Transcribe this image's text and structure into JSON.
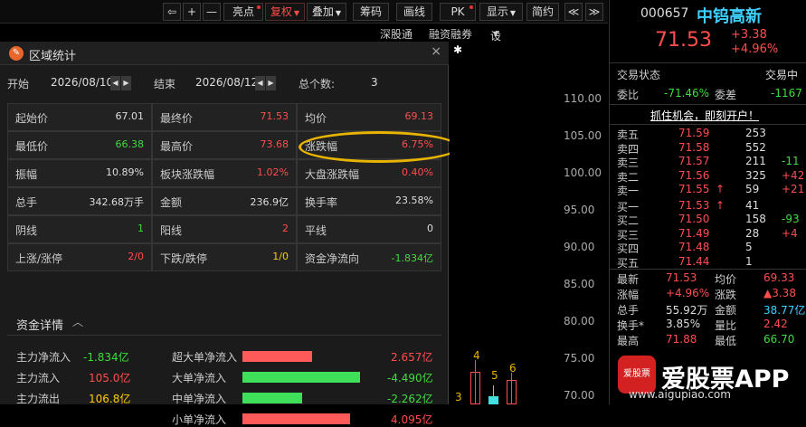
{
  "toolbar": {
    "back": "⇦",
    "plus": "+",
    "minus": "—",
    "liangdian": "亮点",
    "fuquan": "复权",
    "diejia": "叠加",
    "chouma": "筹码",
    "huaxian": "画线",
    "pk": "PK",
    "xianshi": "显示",
    "jianyue": "简约",
    "prev": "≪",
    "next": "≫"
  },
  "subbar": {
    "shengutong": "深股通",
    "rongzi": "融资融券",
    "junxian": "设置均线"
  },
  "panel": {
    "title": "区域统计",
    "close": "×",
    "range": {
      "start_label": "开始",
      "start": "2026/08/10",
      "end_label": "结束",
      "end": "2026/08/12",
      "count_label": "总个数:",
      "count": "3"
    },
    "cells": [
      {
        "label": "起始价",
        "value": "67.01"
      },
      {
        "label": "最终价",
        "value": "71.53"
      },
      {
        "label": "均价",
        "value": "69.13"
      },
      {
        "label": "最低价",
        "value": "66.38"
      },
      {
        "label": "最高价",
        "value": "73.68"
      },
      {
        "label": "涨跌幅",
        "value": "6.75%"
      },
      {
        "label": "振幅",
        "value": "10.89%"
      },
      {
        "label": "板块涨跌幅",
        "value": "1.02%"
      },
      {
        "label": "大盘涨跌幅",
        "value": "0.40%"
      },
      {
        "label": "总手",
        "value": "342.68万手"
      },
      {
        "label": "金额",
        "value": "236.9亿"
      },
      {
        "label": "换手率",
        "value": "23.58%"
      },
      {
        "label": "阴线",
        "value": "1"
      },
      {
        "label": "阳线",
        "value": "2"
      },
      {
        "label": "平线",
        "value": "0"
      },
      {
        "label": "上涨/涨停",
        "value": "2/0"
      },
      {
        "label": "下跌/跌停",
        "value": "1/0"
      },
      {
        "label": "资金净流向",
        "value": "-1.834亿"
      }
    ],
    "fund": {
      "header": "资金详情",
      "chev": "︿",
      "left": [
        {
          "label": "主力净流入",
          "value": "-1.834亿"
        },
        {
          "label": "主力流入",
          "value": "105.0亿"
        },
        {
          "label": "主力流出",
          "value": "106.8亿"
        }
      ],
      "right": [
        {
          "label": "超大单净流入",
          "value": "2.657亿",
          "level": 0.55
        },
        {
          "label": "大单净流入",
          "value": "-4.490亿",
          "level": 0.93
        },
        {
          "label": "中单净流入",
          "value": "-2.262亿",
          "level": 0.47
        },
        {
          "label": "小单净流入",
          "value": "4.095亿",
          "level": 0.85
        }
      ]
    }
  },
  "chart": {
    "star": "✱",
    "yticks": [
      "110.00",
      "105.00",
      "100.00",
      "95.00",
      "90.00",
      "85.00",
      "80.00",
      "75.00",
      "70.00"
    ],
    "marks": [
      "4",
      "5",
      "6",
      "3"
    ]
  },
  "quote": {
    "code": "000657",
    "name": "中钨高新",
    "price": "71.53",
    "chg": "+3.38",
    "pct": "+4.96%",
    "status_label": "交易状态",
    "status": "交易中",
    "wb_label": "委比",
    "wb": "-71.46%",
    "wc_label": "委差",
    "wc": "-1167",
    "banner": "抓住机会，即刻开户！",
    "asks": [
      {
        "l": "卖五",
        "p": "71.59",
        "v": "253",
        "d": ""
      },
      {
        "l": "卖四",
        "p": "71.58",
        "v": "552",
        "d": ""
      },
      {
        "l": "卖三",
        "p": "71.57",
        "v": "211",
        "d": "-11"
      },
      {
        "l": "卖二",
        "p": "71.56",
        "v": "325",
        "d": "+42"
      },
      {
        "l": "卖一",
        "p": "71.55",
        "v": "59",
        "d": "+21",
        "arrow": "↑"
      }
    ],
    "bids": [
      {
        "l": "买一",
        "p": "71.53",
        "v": "41",
        "d": "",
        "arrow": "↑"
      },
      {
        "l": "买二",
        "p": "71.50",
        "v": "158",
        "d": "-93"
      },
      {
        "l": "买三",
        "p": "71.49",
        "v": "28",
        "d": "+4"
      },
      {
        "l": "买四",
        "p": "71.48",
        "v": "5",
        "d": ""
      },
      {
        "l": "买五",
        "p": "71.44",
        "v": "1",
        "d": ""
      }
    ],
    "stats": [
      {
        "l1": "最新",
        "v1": "71.53",
        "l2": "均价",
        "v2": "69.33"
      },
      {
        "l1": "涨幅",
        "v1": "+4.96%",
        "l2": "涨跌",
        "v2": "▲3.38"
      },
      {
        "l1": "总手",
        "v1": "55.92万",
        "l2": "金额",
        "v2": "38.77亿"
      },
      {
        "l1": "换手*",
        "v1": "3.85%",
        "l2": "量比",
        "v2": "2.42"
      },
      {
        "l1": "最高",
        "v1": "71.88",
        "l2": "最低",
        "v2": "66.70"
      }
    ]
  },
  "ad": {
    "icon": "爱股票",
    "text": "爱股票APP",
    "url": "www.aigupiao.com"
  }
}
